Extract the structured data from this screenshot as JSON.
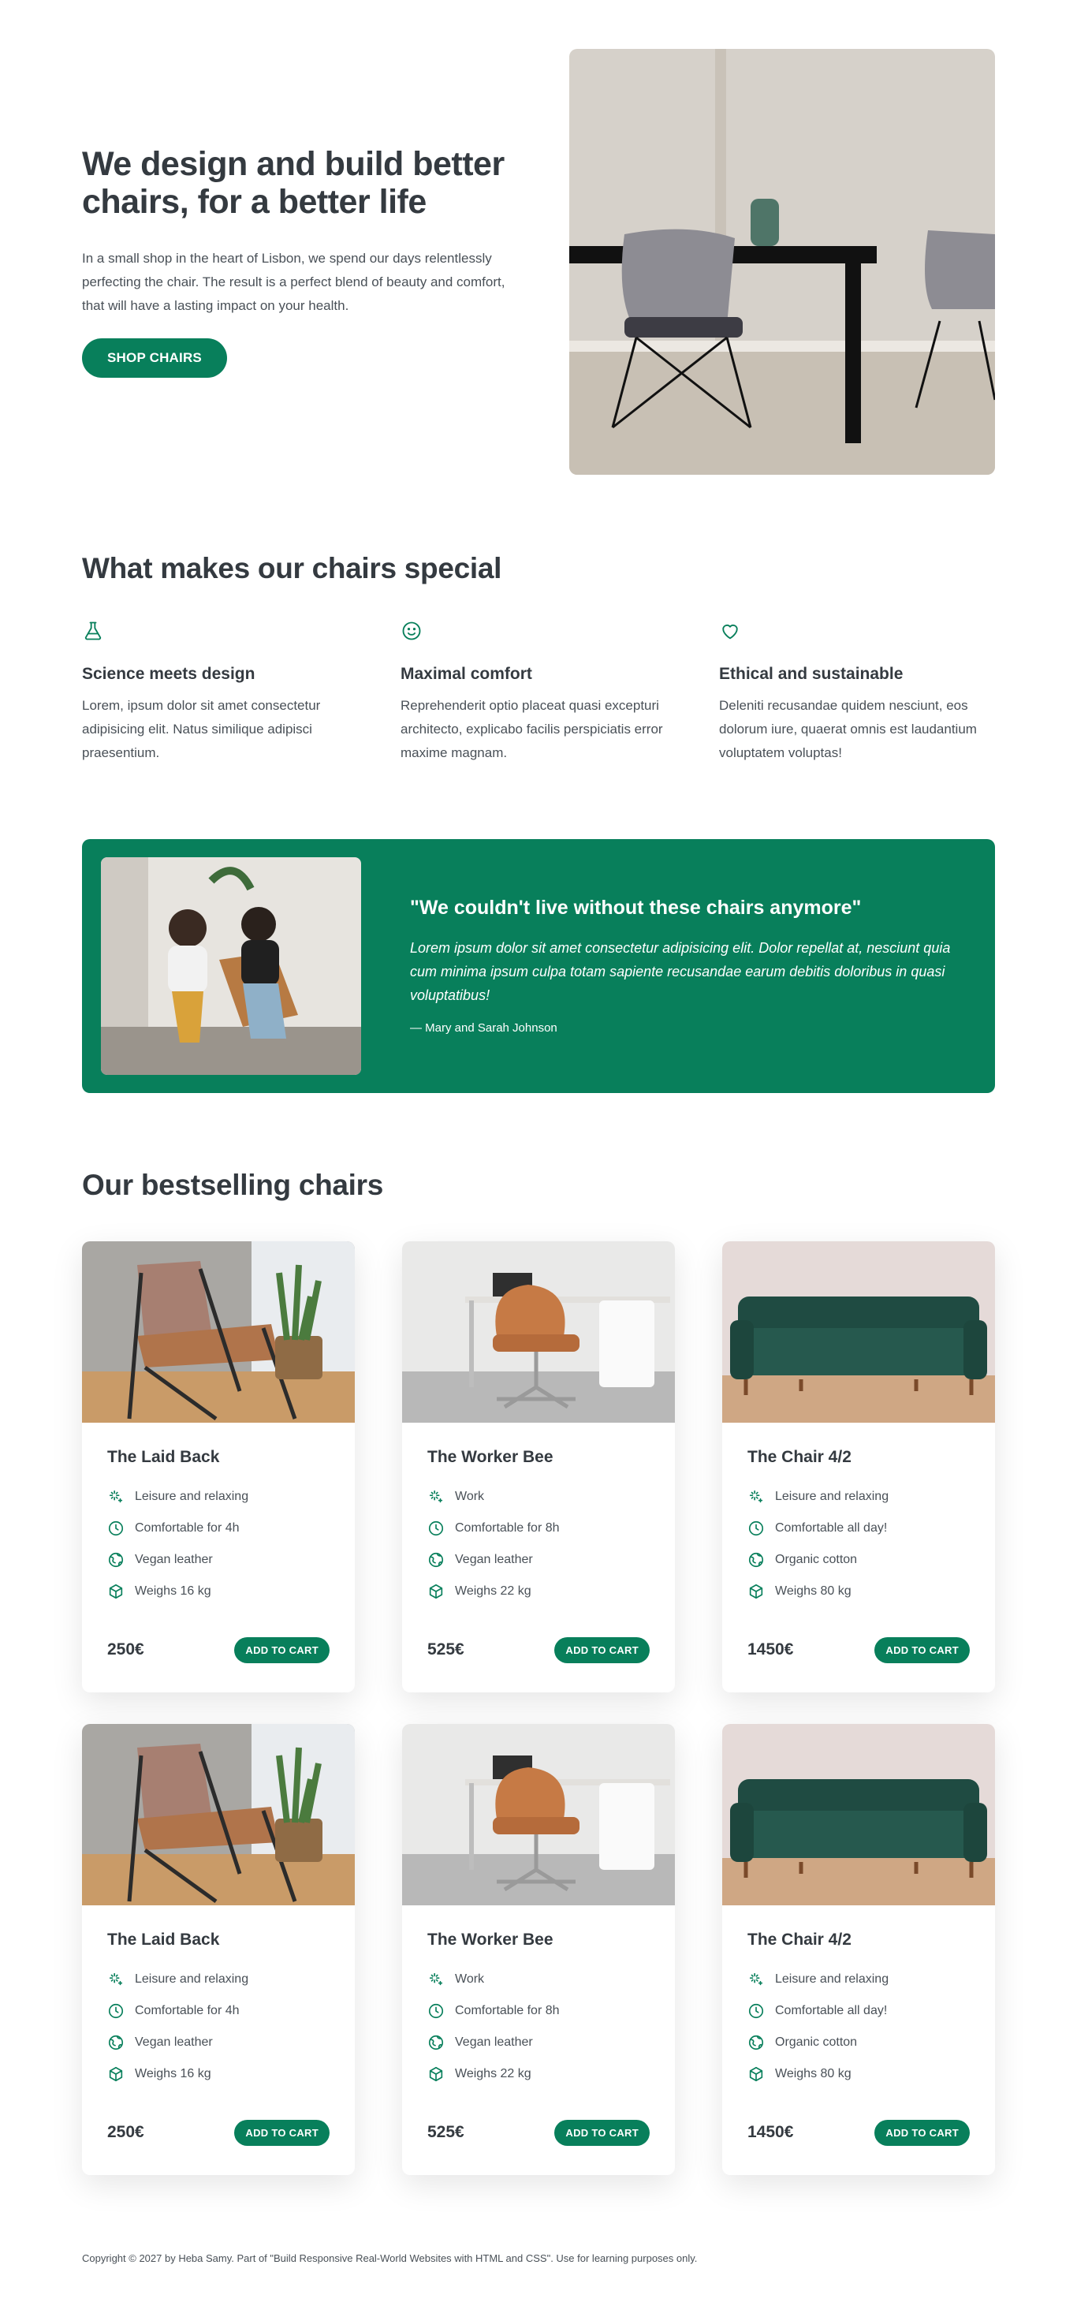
{
  "hero": {
    "title": "We design and build better chairs, for a better life",
    "description": "In a small shop in the heart of Lisbon, we spend our days relentlessly perfecting the chair. The result is a perfect blend of beauty and comfort, that will have a lasting impact on your health.",
    "cta_label": "SHOP CHAIRS",
    "image_icon": "dining-chairs-photo"
  },
  "features": {
    "title": "What makes our chairs special",
    "items": [
      {
        "icon": "flask-icon",
        "title": "Science meets design",
        "text": "Lorem, ipsum dolor sit amet consectetur adipisicing elit. Natus similique adipisci praesentium."
      },
      {
        "icon": "smile-icon",
        "title": "Maximal comfort",
        "text": "Reprehenderit optio placeat quasi excepturi architecto, explicabo facilis perspiciatis error maxime magnam."
      },
      {
        "icon": "heart-icon",
        "title": "Ethical and sustainable",
        "text": "Deleniti recusandae quidem nesciunt, eos dolorum iure, quaerat omnis est laudantium voluptatem voluptas!"
      }
    ]
  },
  "testimonial": {
    "quote": "\"We couldn't live without these chairs anymore\"",
    "text": "Lorem ipsum dolor sit amet consectetur adipisicing elit. Dolor repellat at, nesciunt quia cum minima ipsum culpa totam sapiente recusandae earum debitis doloribus in quasi voluptatibus!",
    "author": "— Mary and Sarah Johnson"
  },
  "products": {
    "title": "Our bestselling chairs",
    "cart_label": "ADD TO CART",
    "items": [
      {
        "name": "The Laid Back",
        "attrs": [
          "Leisure and relaxing",
          "Comfortable for 4h",
          "Vegan leather",
          "Weighs 16 kg"
        ],
        "price": "250€",
        "image": "lounge-chair"
      },
      {
        "name": "The Worker Bee",
        "attrs": [
          "Work",
          "Comfortable for 8h",
          "Vegan leather",
          "Weighs 22 kg"
        ],
        "price": "525€",
        "image": "office-chair"
      },
      {
        "name": "The Chair 4/2",
        "attrs": [
          "Leisure and relaxing",
          "Comfortable all day!",
          "Organic cotton",
          "Weighs 80 kg"
        ],
        "price": "1450€",
        "image": "sofa"
      },
      {
        "name": "The Laid Back",
        "attrs": [
          "Leisure and relaxing",
          "Comfortable for 4h",
          "Vegan leather",
          "Weighs 16 kg"
        ],
        "price": "250€",
        "image": "lounge-chair"
      },
      {
        "name": "The Worker Bee",
        "attrs": [
          "Work",
          "Comfortable for 8h",
          "Vegan leather",
          "Weighs 22 kg"
        ],
        "price": "525€",
        "image": "office-chair"
      },
      {
        "name": "The Chair 4/2",
        "attrs": [
          "Leisure and relaxing",
          "Comfortable all day!",
          "Organic cotton",
          "Weighs 80 kg"
        ],
        "price": "1450€",
        "image": "sofa"
      }
    ]
  },
  "footer": {
    "text": "Copyright © 2027 by Heba Samy. Part of \"Build Responsive Real-World Websites with HTML and CSS\". Use for learning purposes only."
  },
  "colors": {
    "primary": "#087f5b",
    "text": "#343a40",
    "muted": "#495057"
  }
}
